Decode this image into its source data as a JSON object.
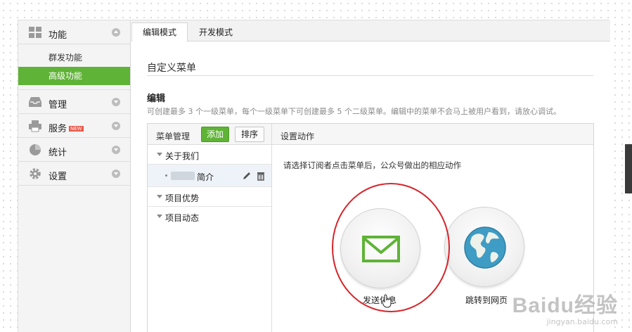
{
  "sidebar": {
    "groups": [
      {
        "label": "功能",
        "icon": "grid-icon"
      },
      {
        "label": "管理",
        "icon": "inbox-icon"
      },
      {
        "label": "服务",
        "icon": "printer-icon",
        "badge": "NEW"
      },
      {
        "label": "统计",
        "icon": "pie-chart-icon"
      },
      {
        "label": "设置",
        "icon": "gear-icon"
      }
    ],
    "sub_items": [
      "群发功能",
      "高级功能"
    ]
  },
  "tabs": [
    "编辑模式",
    "开发模式"
  ],
  "section_title": "自定义菜单",
  "edit": {
    "title": "编辑",
    "hint": "可创建最多 3 个一级菜单，每个一级菜单下可创建最多 5 个二级菜单。编辑中的菜单不会马上被用户看到，请放心调试。"
  },
  "menu_panel": {
    "header": "菜单管理",
    "add_button": "添加",
    "sort_button": "排序",
    "items": [
      "关于我们",
      "简介",
      "项目优势",
      "项目动态"
    ]
  },
  "action_panel": {
    "header": "设置动作",
    "hint": "请选择订阅者点击菜单后，公众号做出的相应动作",
    "options": [
      "发送信息",
      "跳转到网页"
    ]
  },
  "colors": {
    "accent": "#5fb336",
    "highlight_ring": "#d6242a"
  },
  "watermark": {
    "logo": "Baidu经验",
    "url": "jingyan.baidu.com"
  }
}
